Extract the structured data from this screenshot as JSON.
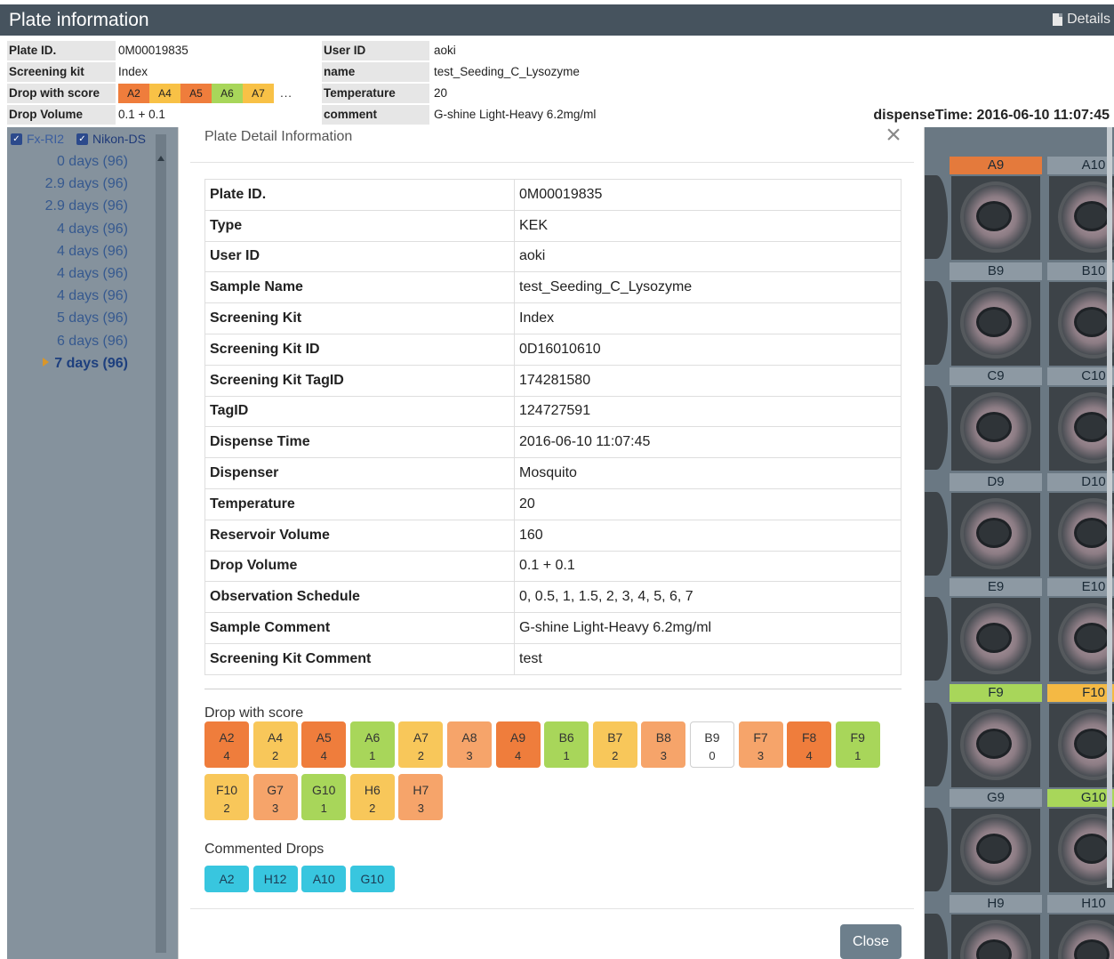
{
  "header": {
    "title": "Plate information",
    "details_label": "Details"
  },
  "info": {
    "left": [
      {
        "label": "Plate ID.",
        "value": "0M00019835"
      },
      {
        "label": "Screening kit",
        "value": "Index"
      },
      {
        "label": "Drop with score",
        "value": ""
      },
      {
        "label": "Drop Volume",
        "value": "0.1 + 0.1"
      }
    ],
    "right": [
      {
        "label": "User ID",
        "value": "aoki"
      },
      {
        "label": "name",
        "value": "test_Seeding_C_Lysozyme"
      },
      {
        "label": "Temperature",
        "value": "20"
      },
      {
        "label": "comment",
        "value": "G-shine Light-Heavy 6.2mg/ml"
      }
    ],
    "mini_chips": [
      {
        "label": "A2",
        "color": "#ef7d3c"
      },
      {
        "label": "A4",
        "color": "#f8c146"
      },
      {
        "label": "A5",
        "color": "#ef7d3c"
      },
      {
        "label": "A6",
        "color": "#a8d65a"
      },
      {
        "label": "A7",
        "color": "#f8c146"
      }
    ],
    "mini_more": "...",
    "dispense_time": "dispenseTime: 2016-06-10 11:07:45"
  },
  "sidebar": {
    "cameras": [
      {
        "label": "Fx-RI2",
        "checked": true
      },
      {
        "label": "Nikon-DS",
        "checked": true
      }
    ],
    "days": [
      "0 days (96)",
      "2.9 days (96)",
      "2.9 days (96)",
      "4 days (96)",
      "4 days (96)",
      "4 days (96)",
      "4 days (96)",
      "5 days (96)",
      "6 days (96)",
      "7 days (96)"
    ]
  },
  "plate": {
    "cells": [
      {
        "label": "A9",
        "color": "#e47a3c"
      },
      {
        "label": "A10",
        "color": "#8d99a3"
      },
      {
        "label": "B9",
        "color": "#8d99a3"
      },
      {
        "label": "B10",
        "color": "#8d99a3"
      },
      {
        "label": "C9",
        "color": "#8d99a3"
      },
      {
        "label": "C10",
        "color": "#8d99a3"
      },
      {
        "label": "D9",
        "color": "#8d99a3"
      },
      {
        "label": "D10",
        "color": "#8d99a3"
      },
      {
        "label": "E9",
        "color": "#8d99a3"
      },
      {
        "label": "E10",
        "color": "#8d99a3"
      },
      {
        "label": "F9",
        "color": "#a8d65a"
      },
      {
        "label": "F10",
        "color": "#f4b944"
      },
      {
        "label": "G9",
        "color": "#8d99a3"
      },
      {
        "label": "G10",
        "color": "#a8d65a"
      },
      {
        "label": "H9",
        "color": "#8d99a3"
      },
      {
        "label": "H10",
        "color": "#8d99a3"
      }
    ]
  },
  "modal": {
    "title": "Plate Detail Information",
    "close_icon": "close-icon",
    "rows": [
      {
        "key": "Plate ID.",
        "value": "0M00019835"
      },
      {
        "key": "Type",
        "value": "KEK"
      },
      {
        "key": "User ID",
        "value": "aoki"
      },
      {
        "key": "Sample Name",
        "value": "test_Seeding_C_Lysozyme"
      },
      {
        "key": "Screening Kit",
        "value": "Index"
      },
      {
        "key": "Screening Kit ID",
        "value": "0D16010610"
      },
      {
        "key": "Screening Kit TagID",
        "value": "174281580"
      },
      {
        "key": "TagID",
        "value": "124727591"
      },
      {
        "key": "Dispense Time",
        "value": "2016-06-10 11:07:45"
      },
      {
        "key": "Dispenser",
        "value": "Mosquito"
      },
      {
        "key": "Temperature",
        "value": "20"
      },
      {
        "key": "Reservoir Volume",
        "value": "160"
      },
      {
        "key": "Drop Volume",
        "value": "0.1 + 0.1"
      },
      {
        "key": "Observation Schedule",
        "value": "0, 0.5, 1, 1.5, 2, 3, 4, 5, 6, 7"
      },
      {
        "key": "Sample Comment",
        "value": "G-shine Light-Heavy 6.2mg/ml"
      },
      {
        "key": "Screening Kit Comment",
        "value": "test"
      }
    ],
    "drop_score_title": "Drop with score",
    "score_colors": {
      "0": "#ffffff",
      "1": "#a8d65a",
      "2": "#f8c75a",
      "3": "#f6a46a",
      "4": "#ef7d3c"
    },
    "drops": [
      {
        "well": "A2",
        "score": "4"
      },
      {
        "well": "A4",
        "score": "2"
      },
      {
        "well": "A5",
        "score": "4"
      },
      {
        "well": "A6",
        "score": "1"
      },
      {
        "well": "A7",
        "score": "2"
      },
      {
        "well": "A8",
        "score": "3"
      },
      {
        "well": "A9",
        "score": "4"
      },
      {
        "well": "B6",
        "score": "1"
      },
      {
        "well": "B7",
        "score": "2"
      },
      {
        "well": "B8",
        "score": "3"
      },
      {
        "well": "B9",
        "score": "0"
      },
      {
        "well": "F7",
        "score": "3"
      },
      {
        "well": "F8",
        "score": "4"
      },
      {
        "well": "F9",
        "score": "1"
      },
      {
        "well": "F10",
        "score": "2"
      },
      {
        "well": "G7",
        "score": "3"
      },
      {
        "well": "G10",
        "score": "1"
      },
      {
        "well": "H6",
        "score": "2"
      },
      {
        "well": "H7",
        "score": "3"
      }
    ],
    "commented_title": "Commented Drops",
    "commented": [
      "A2",
      "H12",
      "A10",
      "G10"
    ],
    "close_label": "Close"
  }
}
